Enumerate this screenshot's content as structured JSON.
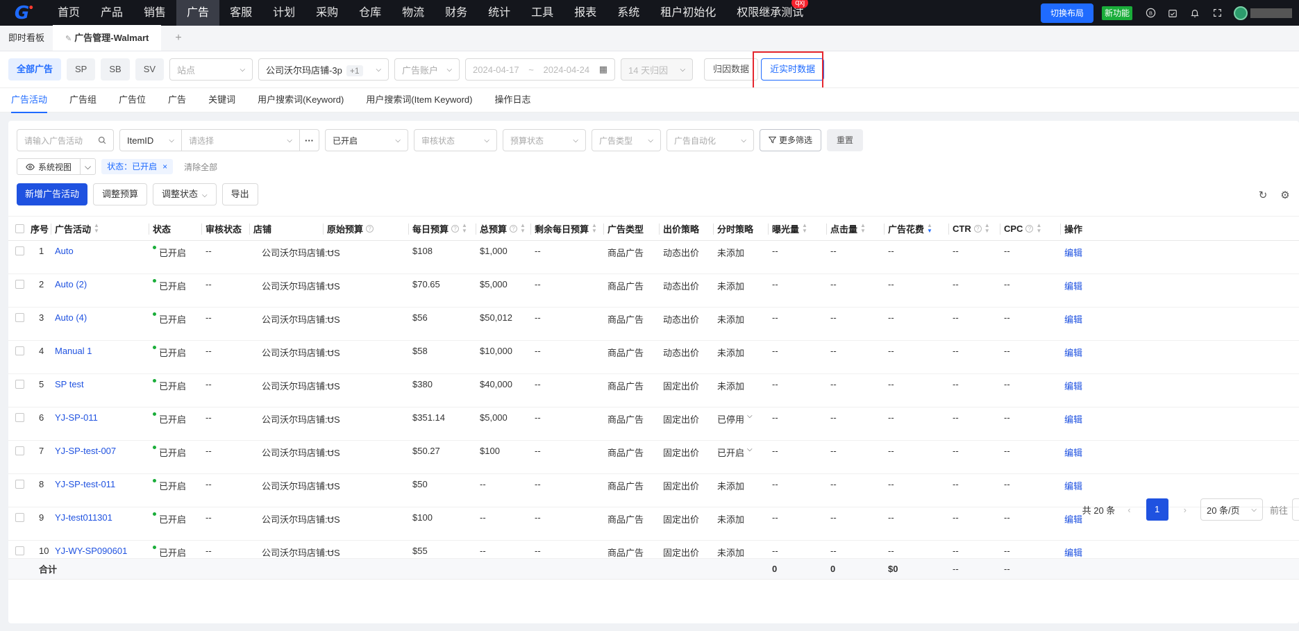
{
  "nav": {
    "logo": "G",
    "items": [
      "首页",
      "产品",
      "销售",
      "广告",
      "客服",
      "计划",
      "采购",
      "仓库",
      "物流",
      "财务",
      "统计",
      "工具",
      "报表",
      "系统",
      "租户初始化",
      "权限继承测试"
    ],
    "active_index": 3,
    "badge": "qxj",
    "switch_layout": "切换布局",
    "new_feature": "新功能"
  },
  "tabs": {
    "items": [
      "即时看板",
      "广告管理-Walmart"
    ],
    "add": "+"
  },
  "filters": {
    "type_pills": [
      "全部广告",
      "SP",
      "SB",
      "SV"
    ],
    "site_placeholder": "站点",
    "store_value": "公司沃尔玛店铺-3p",
    "store_extra": "+1",
    "account_placeholder": "广告账户",
    "date_start": "2024-04-17",
    "date_sep": "~",
    "date_end": "2024-04-24",
    "attribution_period": "14 天归因",
    "attribution_data": "归因数据",
    "realtime_data": "近实时数据"
  },
  "subtabs": [
    "广告活动",
    "广告组",
    "广告位",
    "广告",
    "关键词",
    "用户搜索词(Keyword)",
    "用户搜索词(Item Keyword)",
    "操作日志"
  ],
  "toolbar": {
    "search_placeholder": "请输入广告活动",
    "itemid_label": "ItemID",
    "itemid_placeholder": "请选择",
    "ellipsis": "···",
    "status_value": "已开启",
    "audit_placeholder": "审核状态",
    "budget_placeholder": "预算状态",
    "adtype_placeholder": "广告类型",
    "automation_placeholder": "广告自动化",
    "more_filters": "更多筛选",
    "reset": "重置",
    "view_label": "系统视图",
    "status_tag": "状态：已开启",
    "clear_all": "清除全部",
    "new_campaign": "新增广告活动",
    "adjust_budget": "调整预算",
    "adjust_status": "调整状态",
    "export": "导出"
  },
  "table": {
    "headers": {
      "seq": "序号",
      "campaign": "广告活动",
      "status": "状态",
      "audit": "审核状态",
      "store": "店铺",
      "orig_budget": "原始预算",
      "daily_budget": "每日预算",
      "total_budget": "总预算",
      "remain_daily": "剩余每日预算",
      "ad_type": "广告类型",
      "bid_strategy": "出价策略",
      "dayparting": "分时策略",
      "impressions": "曝光量",
      "clicks": "点击量",
      "spend": "广告花费",
      "ctr": "CTR",
      "cpc": "CPC",
      "action": "操作"
    },
    "rows": [
      {
        "seq": "1",
        "campaign": "Auto",
        "status": "已开启",
        "audit": "--",
        "store": "公司沃尔玛店铺:US",
        "orig_budget": "--",
        "daily_budget": "$108",
        "total_budget": "$1,000",
        "remain_daily": "--",
        "ad_type": "商品广告",
        "bid_strategy": "动态出价",
        "dayparting": "未添加",
        "impressions": "--",
        "clicks": "--",
        "spend": "--",
        "ctr": "--",
        "cpc": "--",
        "action": "编辑"
      },
      {
        "seq": "2",
        "campaign": "Auto (2)",
        "status": "已开启",
        "audit": "--",
        "store": "公司沃尔玛店铺:US",
        "orig_budget": "--",
        "daily_budget": "$70.65",
        "total_budget": "$5,000",
        "remain_daily": "--",
        "ad_type": "商品广告",
        "bid_strategy": "动态出价",
        "dayparting": "未添加",
        "impressions": "--",
        "clicks": "--",
        "spend": "--",
        "ctr": "--",
        "cpc": "--",
        "action": "编辑"
      },
      {
        "seq": "3",
        "campaign": "Auto (4)",
        "status": "已开启",
        "audit": "--",
        "store": "公司沃尔玛店铺:US",
        "orig_budget": "--",
        "daily_budget": "$56",
        "total_budget": "$50,012",
        "remain_daily": "--",
        "ad_type": "商品广告",
        "bid_strategy": "动态出价",
        "dayparting": "未添加",
        "impressions": "--",
        "clicks": "--",
        "spend": "--",
        "ctr": "--",
        "cpc": "--",
        "action": "编辑"
      },
      {
        "seq": "4",
        "campaign": "Manual 1",
        "status": "已开启",
        "audit": "--",
        "store": "公司沃尔玛店铺:US",
        "orig_budget": "--",
        "daily_budget": "$58",
        "total_budget": "$10,000",
        "remain_daily": "--",
        "ad_type": "商品广告",
        "bid_strategy": "动态出价",
        "dayparting": "未添加",
        "impressions": "--",
        "clicks": "--",
        "spend": "--",
        "ctr": "--",
        "cpc": "--",
        "action": "编辑"
      },
      {
        "seq": "5",
        "campaign": "SP test",
        "status": "已开启",
        "audit": "--",
        "store": "公司沃尔玛店铺:US",
        "orig_budget": "--",
        "daily_budget": "$380",
        "total_budget": "$40,000",
        "remain_daily": "--",
        "ad_type": "商品广告",
        "bid_strategy": "固定出价",
        "dayparting": "未添加",
        "impressions": "--",
        "clicks": "--",
        "spend": "--",
        "ctr": "--",
        "cpc": "--",
        "action": "编辑"
      },
      {
        "seq": "6",
        "campaign": "YJ-SP-011",
        "status": "已开启",
        "audit": "--",
        "store": "公司沃尔玛店铺:US",
        "orig_budget": "--",
        "daily_budget": "$351.14",
        "total_budget": "$5,000",
        "remain_daily": "--",
        "ad_type": "商品广告",
        "bid_strategy": "固定出价",
        "dayparting": "已停用",
        "dayparting_dropdown": true,
        "impressions": "--",
        "clicks": "--",
        "spend": "--",
        "ctr": "--",
        "cpc": "--",
        "action": "编辑"
      },
      {
        "seq": "7",
        "campaign": "YJ-SP-test-007",
        "status": "已开启",
        "audit": "--",
        "store": "公司沃尔玛店铺:US",
        "orig_budget": "--",
        "daily_budget": "$50.27",
        "total_budget": "$100",
        "remain_daily": "--",
        "ad_type": "商品广告",
        "bid_strategy": "固定出价",
        "dayparting": "已开启",
        "dayparting_dropdown": true,
        "impressions": "--",
        "clicks": "--",
        "spend": "--",
        "ctr": "--",
        "cpc": "--",
        "action": "编辑"
      },
      {
        "seq": "8",
        "campaign": "YJ-SP-test-011",
        "status": "已开启",
        "audit": "--",
        "store": "公司沃尔玛店铺:US",
        "orig_budget": "--",
        "daily_budget": "$50",
        "total_budget": "--",
        "remain_daily": "--",
        "ad_type": "商品广告",
        "bid_strategy": "固定出价",
        "dayparting": "未添加",
        "impressions": "--",
        "clicks": "--",
        "spend": "--",
        "ctr": "--",
        "cpc": "--",
        "action": "编辑"
      },
      {
        "seq": "9",
        "campaign": "YJ-test011301",
        "status": "已开启",
        "audit": "--",
        "store": "公司沃尔玛店铺:US",
        "orig_budget": "--",
        "daily_budget": "$100",
        "total_budget": "--",
        "remain_daily": "--",
        "ad_type": "商品广告",
        "bid_strategy": "固定出价",
        "dayparting": "未添加",
        "impressions": "--",
        "clicks": "--",
        "spend": "--",
        "ctr": "--",
        "cpc": "--",
        "action": "编辑"
      },
      {
        "seq": "10",
        "campaign": "YJ-WY-SP090601",
        "status": "已开启",
        "audit": "--",
        "store": "公司沃尔玛店铺:US",
        "orig_budget": "--",
        "daily_budget": "$55",
        "total_budget": "--",
        "remain_daily": "--",
        "ad_type": "商品广告",
        "bid_strategy": "固定出价",
        "dayparting": "未添加",
        "impressions": "--",
        "clicks": "--",
        "spend": "--",
        "ctr": "--",
        "cpc": "--",
        "action": "编辑"
      }
    ],
    "totals": {
      "label": "合计",
      "impressions": "0",
      "clicks": "0",
      "spend": "$0",
      "ctr": "--",
      "cpc": "--"
    }
  },
  "pagination": {
    "total": "共 20 条",
    "current": "1",
    "page_size": "20 条/页",
    "goto": "前往"
  },
  "colors": {
    "accent": "#1f52e0",
    "status_green": "#1aad3a",
    "highlight_red": "#e5262e"
  }
}
